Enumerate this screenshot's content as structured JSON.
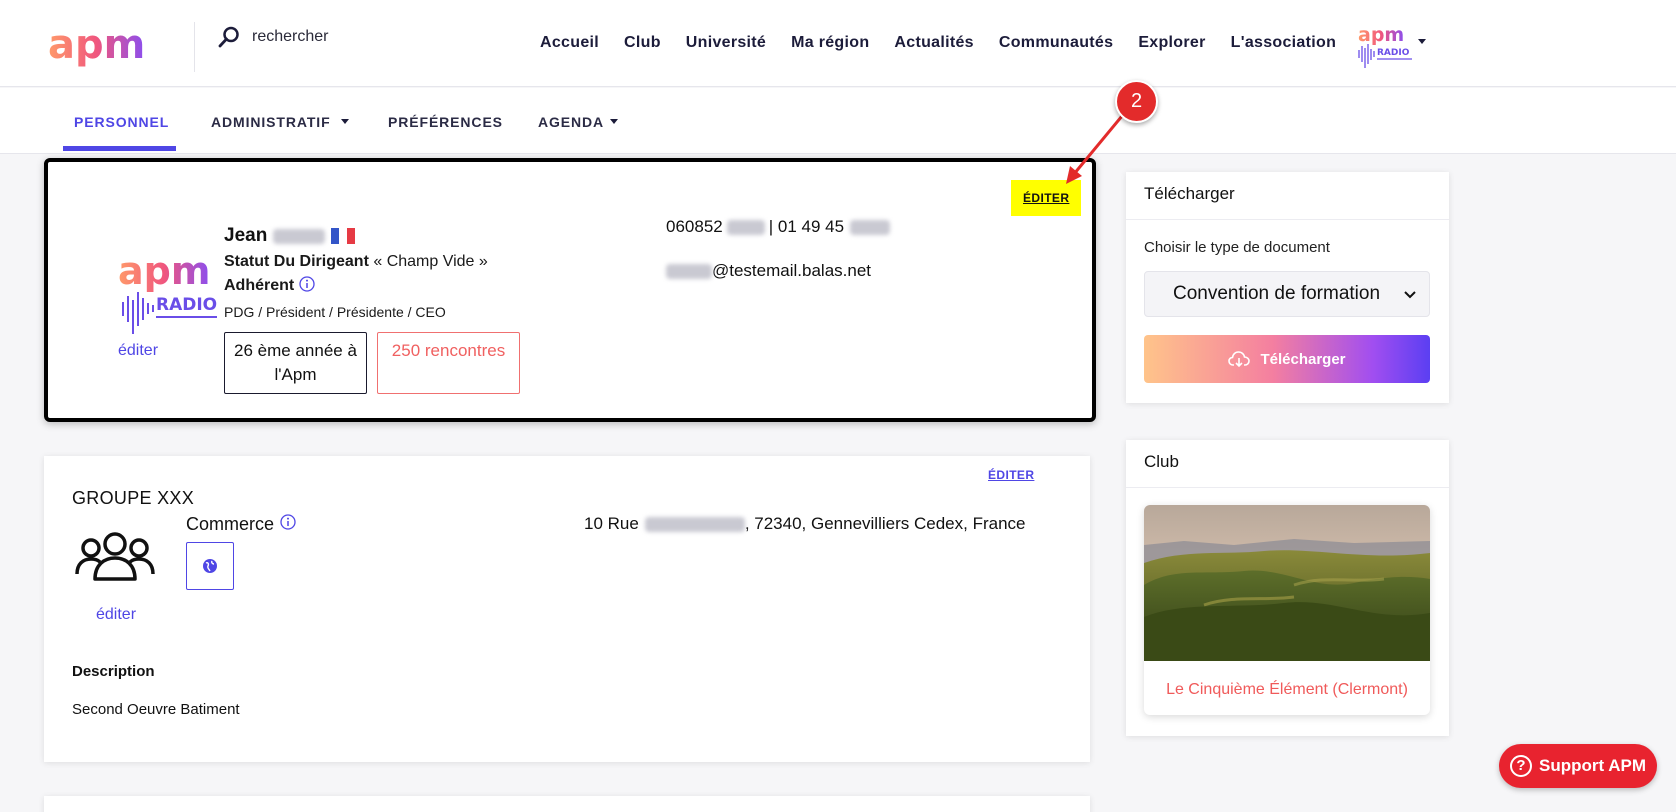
{
  "header": {
    "logo_text": "apm",
    "search_placeholder": "rechercher",
    "nav": [
      "Accueil",
      "Club",
      "Université",
      "Ma région",
      "Actualités",
      "Communautés",
      "Explorer",
      "L'association"
    ],
    "radio_logo": {
      "top": "apm",
      "bottom": "RADIO"
    }
  },
  "tabs": [
    "PERSONNEL",
    "ADMINISTRATIF",
    "PRÉFÉRENCES",
    "AGENDA"
  ],
  "active_tab": "PERSONNEL",
  "annotation": {
    "step": "2"
  },
  "profile": {
    "edit_label": "ÉDITER",
    "logo_text": {
      "top": "apm",
      "bottom": "RADIO"
    },
    "avatar_edit": "éditer",
    "first_name": "Jean",
    "status_label": "Statut Du Dirigeant",
    "status_value": "« Champ Vide »",
    "membership": "Adhérent",
    "roles": "PDG / Président / Présidente / CEO",
    "years": "26 ème année à l'Apm",
    "meetings": "250 rencontres",
    "phone_prefix": "060852",
    "phone_sep": "| 01 49 45",
    "email_domain": "@testemail.balas.net"
  },
  "group": {
    "edit_label": "ÉDITER",
    "name": "GROUPE XXX",
    "sector": "Commerce",
    "avatar_edit": "éditer",
    "address_start": "10 Rue",
    "address_end": ", 72340, Gennevilliers Cedex, France",
    "description_label": "Description",
    "description": "Second Oeuvre Batiment"
  },
  "download": {
    "title": "Télécharger",
    "label": "Choisir le type de document",
    "selected": "Convention de formation",
    "button": "Télécharger"
  },
  "club": {
    "title": "Club",
    "name": "Le Cinquième Élément (Clermont)"
  },
  "support": {
    "label": "Support APM"
  },
  "colors": {
    "accent": "#4f46e5",
    "coral": "#f05a5a",
    "support": "#e8232f",
    "highlight": "#ffff00"
  }
}
